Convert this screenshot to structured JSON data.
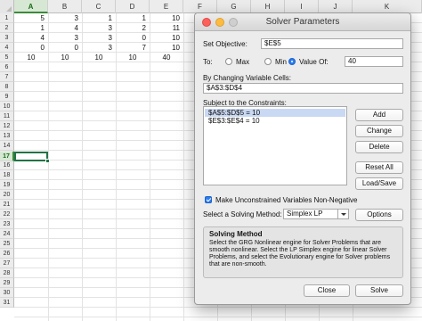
{
  "sheet": {
    "columns": [
      "A",
      "B",
      "C",
      "D",
      "E",
      "F",
      "G",
      "H",
      "I",
      "J",
      "K"
    ],
    "selected_column": "A",
    "rows": [
      "1",
      "2",
      "3",
      "4",
      "5",
      "6",
      "7",
      "8",
      "9",
      "10",
      "11",
      "12",
      "13",
      "14",
      "15",
      "16",
      "17",
      "18",
      "19",
      "20",
      "21",
      "22",
      "23",
      "24",
      "25",
      "26",
      "27",
      "28",
      "29",
      "30",
      "31"
    ],
    "selected_row": "17",
    "cells": [
      [
        "5",
        "3",
        "1",
        "1",
        "10"
      ],
      [
        "1",
        "4",
        "3",
        "2",
        "11"
      ],
      [
        "4",
        "3",
        "3",
        "0",
        "10"
      ],
      [
        "0",
        "0",
        "3",
        "7",
        "10"
      ],
      [
        "10",
        "10",
        "10",
        "10",
        "40"
      ]
    ]
  },
  "dialog": {
    "title": "Solver Parameters",
    "set_objective_label": "Set Objective:",
    "objective_value": "$E$5",
    "to_label": "To:",
    "max_label": "Max",
    "min_label": "Min",
    "value_of_label": "Value Of:",
    "value_of": "40",
    "changing_cells_label": "By Changing Variable Cells:",
    "changing_cells_value": "$A$3:$D$4",
    "constraints_label": "Subject to the Constraints:",
    "constraints": [
      "$A$5:$D$5 = 10",
      "$E$3:$E$4 = 10"
    ],
    "buttons": {
      "add": "Add",
      "change": "Change",
      "delete": "Delete",
      "reset_all": "Reset All",
      "load_save": "Load/Save",
      "options": "Options",
      "close": "Close",
      "solve": "Solve"
    },
    "nonneg_label": "Make Unconstrained Variables Non-Negative",
    "nonneg_checked": true,
    "method_label": "Select a Solving Method:",
    "method_value": "Simplex LP",
    "solving_method_title": "Solving Method",
    "solving_method_text": "Select the GRG Nonlinear engine for Solver Problems that are smooth nonlinear. Select the LP Simplex engine for linear Solver Problems, and select the Evolutionary engine for Solver problems that are non-smooth."
  },
  "colors": {
    "accent": "#2b7cf2",
    "selection_green": "#217346",
    "close_dot": "#fc605c",
    "minimize_dot": "#fdbc40"
  }
}
